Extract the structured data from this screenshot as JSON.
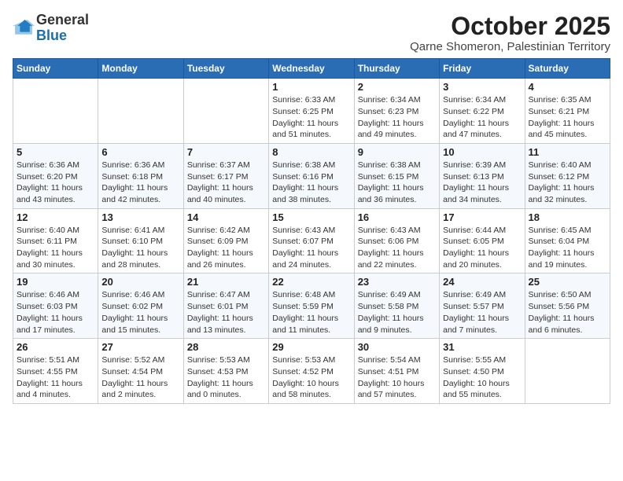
{
  "header": {
    "logo_general": "General",
    "logo_blue": "Blue",
    "month": "October 2025",
    "location": "Qarne Shomeron, Palestinian Territory"
  },
  "weekdays": [
    "Sunday",
    "Monday",
    "Tuesday",
    "Wednesday",
    "Thursday",
    "Friday",
    "Saturday"
  ],
  "weeks": [
    [
      {
        "day": "",
        "info": ""
      },
      {
        "day": "",
        "info": ""
      },
      {
        "day": "",
        "info": ""
      },
      {
        "day": "1",
        "info": "Sunrise: 6:33 AM\nSunset: 6:25 PM\nDaylight: 11 hours\nand 51 minutes."
      },
      {
        "day": "2",
        "info": "Sunrise: 6:34 AM\nSunset: 6:23 PM\nDaylight: 11 hours\nand 49 minutes."
      },
      {
        "day": "3",
        "info": "Sunrise: 6:34 AM\nSunset: 6:22 PM\nDaylight: 11 hours\nand 47 minutes."
      },
      {
        "day": "4",
        "info": "Sunrise: 6:35 AM\nSunset: 6:21 PM\nDaylight: 11 hours\nand 45 minutes."
      }
    ],
    [
      {
        "day": "5",
        "info": "Sunrise: 6:36 AM\nSunset: 6:20 PM\nDaylight: 11 hours\nand 43 minutes."
      },
      {
        "day": "6",
        "info": "Sunrise: 6:36 AM\nSunset: 6:18 PM\nDaylight: 11 hours\nand 42 minutes."
      },
      {
        "day": "7",
        "info": "Sunrise: 6:37 AM\nSunset: 6:17 PM\nDaylight: 11 hours\nand 40 minutes."
      },
      {
        "day": "8",
        "info": "Sunrise: 6:38 AM\nSunset: 6:16 PM\nDaylight: 11 hours\nand 38 minutes."
      },
      {
        "day": "9",
        "info": "Sunrise: 6:38 AM\nSunset: 6:15 PM\nDaylight: 11 hours\nand 36 minutes."
      },
      {
        "day": "10",
        "info": "Sunrise: 6:39 AM\nSunset: 6:13 PM\nDaylight: 11 hours\nand 34 minutes."
      },
      {
        "day": "11",
        "info": "Sunrise: 6:40 AM\nSunset: 6:12 PM\nDaylight: 11 hours\nand 32 minutes."
      }
    ],
    [
      {
        "day": "12",
        "info": "Sunrise: 6:40 AM\nSunset: 6:11 PM\nDaylight: 11 hours\nand 30 minutes."
      },
      {
        "day": "13",
        "info": "Sunrise: 6:41 AM\nSunset: 6:10 PM\nDaylight: 11 hours\nand 28 minutes."
      },
      {
        "day": "14",
        "info": "Sunrise: 6:42 AM\nSunset: 6:09 PM\nDaylight: 11 hours\nand 26 minutes."
      },
      {
        "day": "15",
        "info": "Sunrise: 6:43 AM\nSunset: 6:07 PM\nDaylight: 11 hours\nand 24 minutes."
      },
      {
        "day": "16",
        "info": "Sunrise: 6:43 AM\nSunset: 6:06 PM\nDaylight: 11 hours\nand 22 minutes."
      },
      {
        "day": "17",
        "info": "Sunrise: 6:44 AM\nSunset: 6:05 PM\nDaylight: 11 hours\nand 20 minutes."
      },
      {
        "day": "18",
        "info": "Sunrise: 6:45 AM\nSunset: 6:04 PM\nDaylight: 11 hours\nand 19 minutes."
      }
    ],
    [
      {
        "day": "19",
        "info": "Sunrise: 6:46 AM\nSunset: 6:03 PM\nDaylight: 11 hours\nand 17 minutes."
      },
      {
        "day": "20",
        "info": "Sunrise: 6:46 AM\nSunset: 6:02 PM\nDaylight: 11 hours\nand 15 minutes."
      },
      {
        "day": "21",
        "info": "Sunrise: 6:47 AM\nSunset: 6:01 PM\nDaylight: 11 hours\nand 13 minutes."
      },
      {
        "day": "22",
        "info": "Sunrise: 6:48 AM\nSunset: 5:59 PM\nDaylight: 11 hours\nand 11 minutes."
      },
      {
        "day": "23",
        "info": "Sunrise: 6:49 AM\nSunset: 5:58 PM\nDaylight: 11 hours\nand 9 minutes."
      },
      {
        "day": "24",
        "info": "Sunrise: 6:49 AM\nSunset: 5:57 PM\nDaylight: 11 hours\nand 7 minutes."
      },
      {
        "day": "25",
        "info": "Sunrise: 6:50 AM\nSunset: 5:56 PM\nDaylight: 11 hours\nand 6 minutes."
      }
    ],
    [
      {
        "day": "26",
        "info": "Sunrise: 5:51 AM\nSunset: 4:55 PM\nDaylight: 11 hours\nand 4 minutes."
      },
      {
        "day": "27",
        "info": "Sunrise: 5:52 AM\nSunset: 4:54 PM\nDaylight: 11 hours\nand 2 minutes."
      },
      {
        "day": "28",
        "info": "Sunrise: 5:53 AM\nSunset: 4:53 PM\nDaylight: 11 hours\nand 0 minutes."
      },
      {
        "day": "29",
        "info": "Sunrise: 5:53 AM\nSunset: 4:52 PM\nDaylight: 10 hours\nand 58 minutes."
      },
      {
        "day": "30",
        "info": "Sunrise: 5:54 AM\nSunset: 4:51 PM\nDaylight: 10 hours\nand 57 minutes."
      },
      {
        "day": "31",
        "info": "Sunrise: 5:55 AM\nSunset: 4:50 PM\nDaylight: 10 hours\nand 55 minutes."
      },
      {
        "day": "",
        "info": ""
      }
    ]
  ]
}
